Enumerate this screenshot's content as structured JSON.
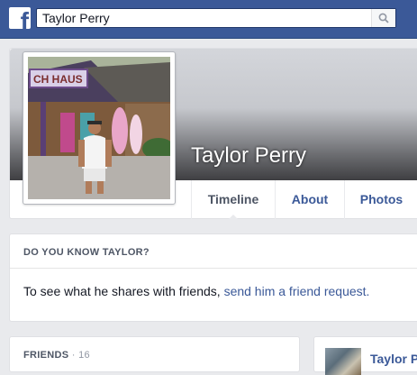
{
  "header": {
    "logo_letter": "f",
    "search_value": "Taylor Perry"
  },
  "profile": {
    "name": "Taylor Perry",
    "picture_sign_text": "CH HAUS",
    "tabs": [
      {
        "label": "Timeline"
      },
      {
        "label": "About"
      },
      {
        "label": "Photos"
      }
    ]
  },
  "know": {
    "title": "DO YOU KNOW TAYLOR?",
    "text": "To see what he shares with friends, ",
    "link": "send him a friend request."
  },
  "friends": {
    "title": "FRIENDS",
    "separator": " · ",
    "count": "16"
  },
  "suggestion": {
    "name": "Taylor P"
  },
  "colors": {
    "brand_blue": "#3b5998",
    "page_bg": "#e9eaed"
  }
}
